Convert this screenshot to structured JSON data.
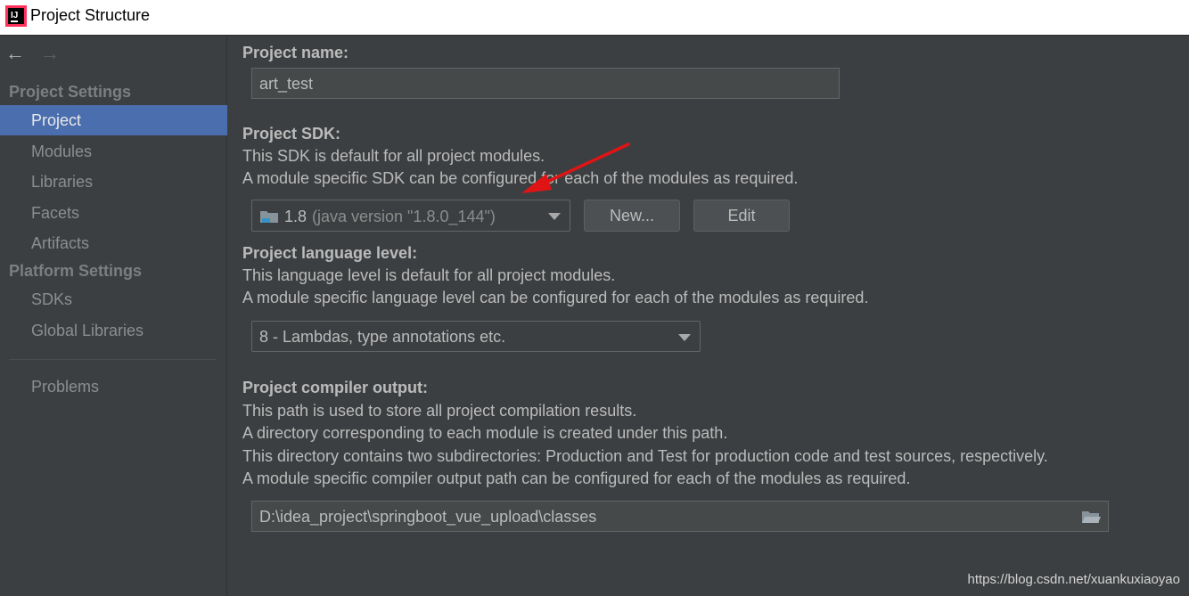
{
  "window": {
    "title": "Project Structure"
  },
  "sidebar": {
    "project_settings_header": "Project Settings",
    "items_project": [
      {
        "label": "Project",
        "selected": true
      },
      {
        "label": "Modules"
      },
      {
        "label": "Libraries"
      },
      {
        "label": "Facets"
      },
      {
        "label": "Artifacts"
      }
    ],
    "platform_settings_header": "Platform Settings",
    "items_platform": [
      {
        "label": "SDKs"
      },
      {
        "label": "Global Libraries"
      }
    ],
    "problems_label": "Problems"
  },
  "main": {
    "project_name": {
      "label": "Project name:",
      "value": "art_test"
    },
    "sdk": {
      "label": "Project SDK:",
      "desc1": "This SDK is default for all project modules.",
      "desc2": "A module specific SDK can be configured for each of the modules as required.",
      "selected_version": "1.8",
      "selected_detail": "(java version \"1.8.0_144\")",
      "new_button": "New...",
      "edit_button": "Edit"
    },
    "language_level": {
      "label": "Project language level:",
      "desc1": "This language level is default for all project modules.",
      "desc2": "A module specific language level can be configured for each of the modules as required.",
      "selected": "8 - Lambdas, type annotations etc."
    },
    "compiler_output": {
      "label": "Project compiler output:",
      "desc1": "This path is used to store all project compilation results.",
      "desc2": "A directory corresponding to each module is created under this path.",
      "desc3": "This directory contains two subdirectories: Production and Test for production code and test sources, respectively.",
      "desc4": "A module specific compiler output path can be configured for each of the modules as required.",
      "path": "D:\\idea_project\\springboot_vue_upload\\classes"
    }
  },
  "watermark": "https://blog.csdn.net/xuankuxiaoyao",
  "colors": {
    "selection": "#4b6eaf",
    "background": "#3c3f41",
    "annotation_arrow": "#e01414"
  },
  "icons": [
    "intellij-app-icon",
    "back-arrow-icon",
    "forward-arrow-icon",
    "folder-icon",
    "chevron-down-icon",
    "browse-folder-icon"
  ]
}
